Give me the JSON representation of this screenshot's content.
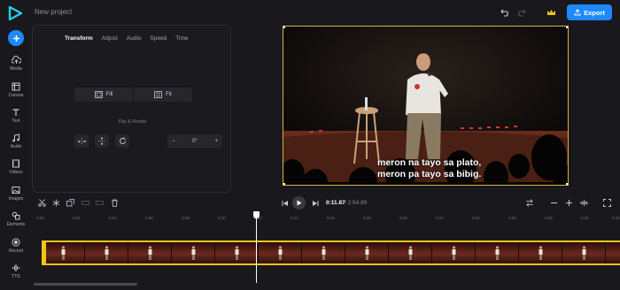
{
  "header": {
    "project_name": "New project",
    "export_label": "Export",
    "colors": {
      "accent": "#1e88ff",
      "crown": "#f2c518",
      "border_selected": "#d9b44a"
    }
  },
  "rail": {
    "items": [
      {
        "label": "Media",
        "icon": "upload-icon"
      },
      {
        "label": "Canvas",
        "icon": "canvas-icon"
      },
      {
        "label": "Text",
        "icon": "text-icon"
      },
      {
        "label": "Audio",
        "icon": "music-icon"
      },
      {
        "label": "Videos",
        "icon": "film-icon"
      },
      {
        "label": "Images",
        "icon": "image-icon"
      },
      {
        "label": "Elements",
        "icon": "shapes-icon"
      },
      {
        "label": "Record",
        "icon": "record-icon"
      },
      {
        "label": "TTS",
        "icon": "waveform-icon"
      }
    ]
  },
  "panel": {
    "tabs": [
      "Transform",
      "Adjust",
      "Audio",
      "Speed",
      "Time"
    ],
    "active_tab": "Transform",
    "fill_label": "Fill",
    "fit_label": "Fit",
    "flip_rotate_label": "Flip & Rotate",
    "rotation_value": "0°"
  },
  "preview": {
    "subtitle_line1": "meron na tayo sa plato,",
    "subtitle_line2": "meron pa tayo sa bibig."
  },
  "timeline": {
    "current_time": "0:11.87",
    "separator": "/",
    "total_time": "2:54.89",
    "ruler_labels": [
      "0:00",
      "0:02",
      "0:04",
      "0:06",
      "0:08",
      "0:10",
      "0:12",
      "0:14",
      "0:16",
      "0:18",
      "0:20",
      "0:22",
      "0:24",
      "0:26",
      "0:28",
      "0:30",
      "0:32"
    ]
  }
}
